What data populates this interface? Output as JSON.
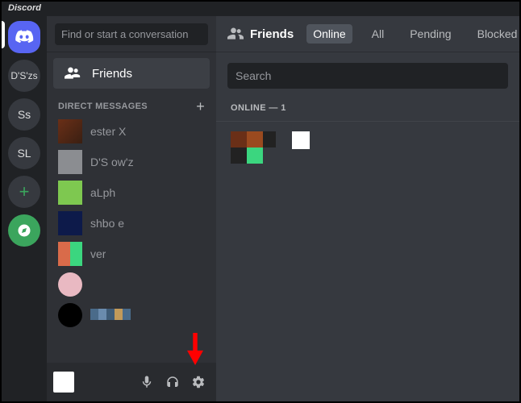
{
  "app": {
    "title": "Discord"
  },
  "rail": {
    "servers": [
      {
        "label": "D'S'zs"
      },
      {
        "label": "Ss"
      },
      {
        "label": "SL"
      }
    ]
  },
  "sidebar": {
    "search_placeholder": "Find or start a conversation",
    "friends_label": "Friends",
    "dm_header": "DIRECT MESSAGES",
    "dms": [
      {
        "name": "ester X",
        "avatar_colors": [
          "#6a2f17",
          "#3a1f12"
        ]
      },
      {
        "name": "D'S ow'z",
        "avatar_colors": [
          "#b9bbbe",
          "#5f6266"
        ]
      },
      {
        "name": "aLph",
        "avatar_colors": [
          "#7ec850",
          "#5aa32c"
        ]
      },
      {
        "name": "shbo e",
        "avatar_colors": [
          "#0d1a4a",
          "#060c26"
        ]
      },
      {
        "name": "ver",
        "avatar_colors": [
          "#d96b4a",
          "#3bd67f"
        ]
      },
      {
        "name": "",
        "avatar_colors": [
          "#e9b9c2",
          "#202225"
        ]
      },
      {
        "name": "",
        "avatar_colors": [
          "#000000",
          "#000000"
        ]
      }
    ]
  },
  "topbar": {
    "friends": "Friends",
    "tabs": {
      "online": "Online",
      "all": "All",
      "pending": "Pending",
      "blocked": "Blocked"
    }
  },
  "main": {
    "search_placeholder": "Search",
    "online_label": "ONLINE — 1"
  }
}
